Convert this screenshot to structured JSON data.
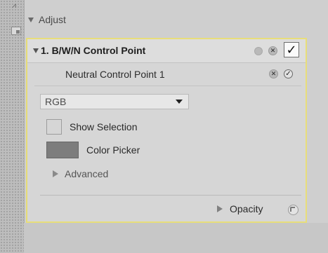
{
  "sidebar": {
    "top_icon": "filter-stack-icon",
    "square_icon": "panel-toggle-icon"
  },
  "adjust": {
    "title": "Adjust"
  },
  "control_point": {
    "title": "1. B/W/N Control Point",
    "enabled": true,
    "neutral": {
      "label": "Neutral Control Point 1",
      "enabled": true
    },
    "channel": {
      "value": "RGB",
      "options": [
        "RGB"
      ]
    },
    "show_selection_label": "Show Selection",
    "show_selection_checked": false,
    "color_picker_label": "Color Picker",
    "color_picker_swatch": "#7d7d7d",
    "advanced_label": "Advanced",
    "opacity_label": "Opacity"
  },
  "colors": {
    "panel_border": "#e8de7a",
    "panel_bg": "#d6d6d6"
  }
}
